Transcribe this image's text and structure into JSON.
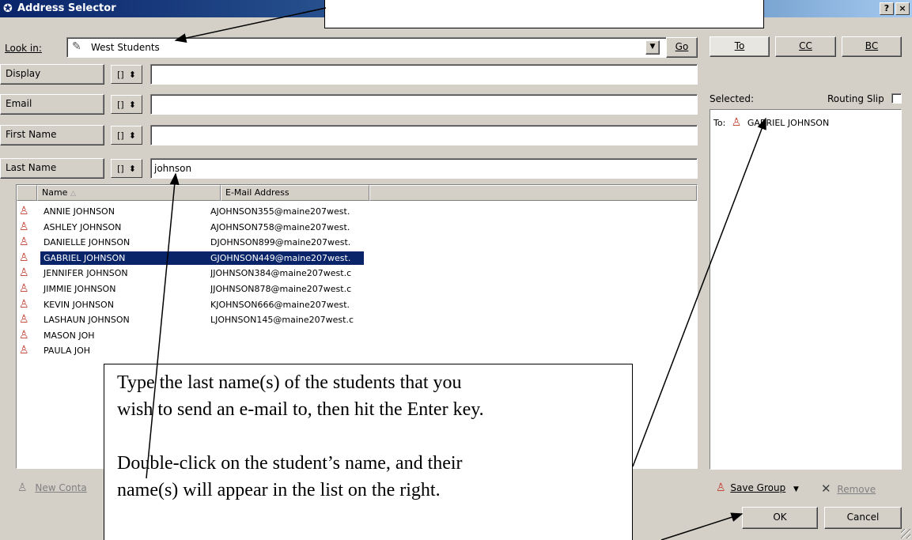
{
  "window": {
    "title": "Address Selector",
    "help_label": "?",
    "close_label": "×"
  },
  "look_in": {
    "label": "Look in:",
    "value": "West Students",
    "go_label": "Go"
  },
  "recipient_tabs": [
    "To",
    "CC",
    "BC"
  ],
  "filters": [
    {
      "label": "Display",
      "op": "[]",
      "value": ""
    },
    {
      "label": "Email",
      "op": "[]",
      "value": ""
    },
    {
      "label": "First Name",
      "op": "[]",
      "value": ""
    },
    {
      "label": "Last Name",
      "op": "[]",
      "value": "johnson"
    }
  ],
  "columns": {
    "name": "Name",
    "email": "E-Mail Address"
  },
  "rows": [
    {
      "name": "ANNIE JOHNSON",
      "email": "AJOHNSON355@maine207west."
    },
    {
      "name": "ASHLEY JOHNSON",
      "email": "AJOHNSON758@maine207west."
    },
    {
      "name": "DANIELLE JOHNSON",
      "email": "DJOHNSON899@maine207west."
    },
    {
      "name": "GABRIEL JOHNSON",
      "email": "GJOHNSON449@maine207west."
    },
    {
      "name": "JENNIFER JOHNSON",
      "email": "JJOHNSON384@maine207west.c"
    },
    {
      "name": "JIMMIE JOHNSON",
      "email": "JJOHNSON878@maine207west.c"
    },
    {
      "name": "KEVIN JOHNSON",
      "email": "KJOHNSON666@maine207west."
    },
    {
      "name": "LASHAUN JOHNSON",
      "email": "LJOHNSON145@maine207west.c"
    },
    {
      "name": "MASON JOH",
      "email": ""
    },
    {
      "name": "PAULA JOH",
      "email": ""
    }
  ],
  "selected_row": 3,
  "selected_panel": {
    "label": "Selected:",
    "routing_slip": "Routing Slip",
    "entry_prefix": "To:",
    "entry_name": "GABRIEL JOHNSON"
  },
  "bottom": {
    "new_contact": "New Conta",
    "save_group": "Save Group",
    "remove": "Remove",
    "ok": "OK",
    "cancel": "Cancel"
  },
  "callout": {
    "line1": "Type the last name(s) of the students that you",
    "line2": "wish to send an e-mail to, then hit the Enter key.",
    "line3": "Double-click on the student’s name, and their",
    "line4": "name(s) will appear in the list on the right."
  },
  "colors": {
    "title_bar": "#0a246a",
    "selection": "#0a246a",
    "face": "#d4d0c8",
    "contact_icon": "#c0392b"
  }
}
